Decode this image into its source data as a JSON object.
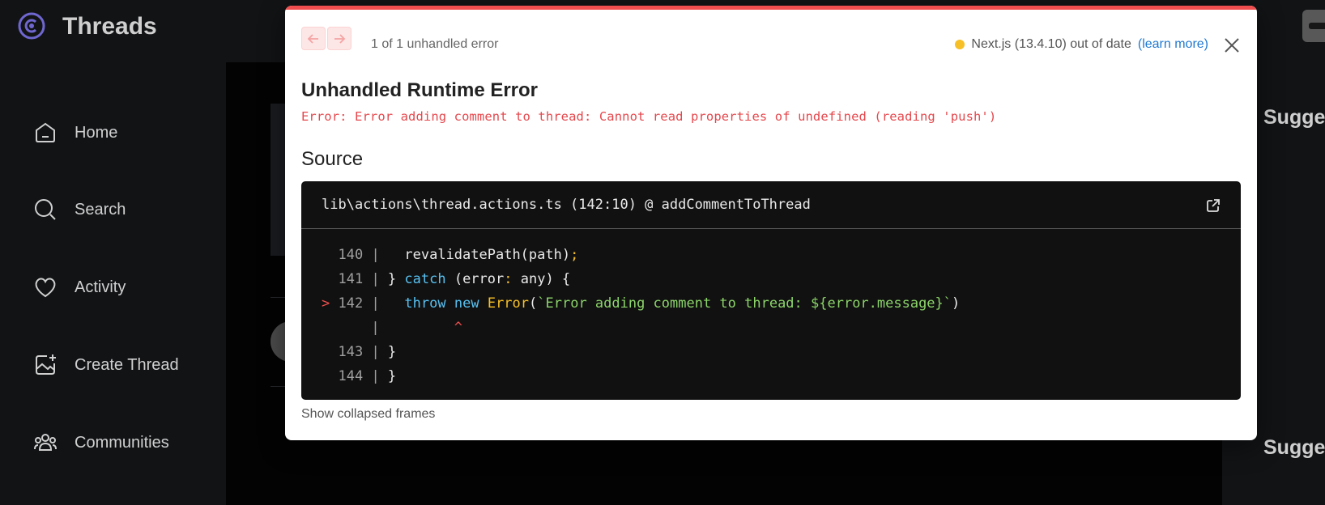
{
  "app": {
    "brand": "Threads",
    "nav": [
      {
        "label": "Home",
        "icon": "home-icon"
      },
      {
        "label": "Search",
        "icon": "search-icon"
      },
      {
        "label": "Activity",
        "icon": "heart-icon"
      },
      {
        "label": "Create Thread",
        "icon": "create-thread-icon"
      },
      {
        "label": "Communities",
        "icon": "communities-icon"
      }
    ],
    "right_headings": [
      "Sugge",
      "Sugge"
    ]
  },
  "dialog": {
    "error_count": "1 of 1 unhandled error",
    "version_text": "Next.js (13.4.10) out of date",
    "learn_more": "(learn more)",
    "title": "Unhandled Runtime Error",
    "error_message": "Error: Error adding comment to thread: Cannot read properties of undefined (reading 'push')",
    "source_heading": "Source",
    "file_location": "lib\\actions\\thread.actions.ts (142:10) @ addCommentToThread",
    "code": {
      "line_numbers": [
        "140",
        "141",
        "142",
        "",
        "143",
        "144"
      ],
      "highlight_marker": ">",
      "caret": "^"
    },
    "collapsed_frames": "Show collapsed frames"
  },
  "colors": {
    "accent_red": "#f04e4e",
    "warning_dot": "#f6c026",
    "link_blue": "#1f78d1",
    "keyword": "#58c0f0",
    "string": "#8bd469"
  }
}
